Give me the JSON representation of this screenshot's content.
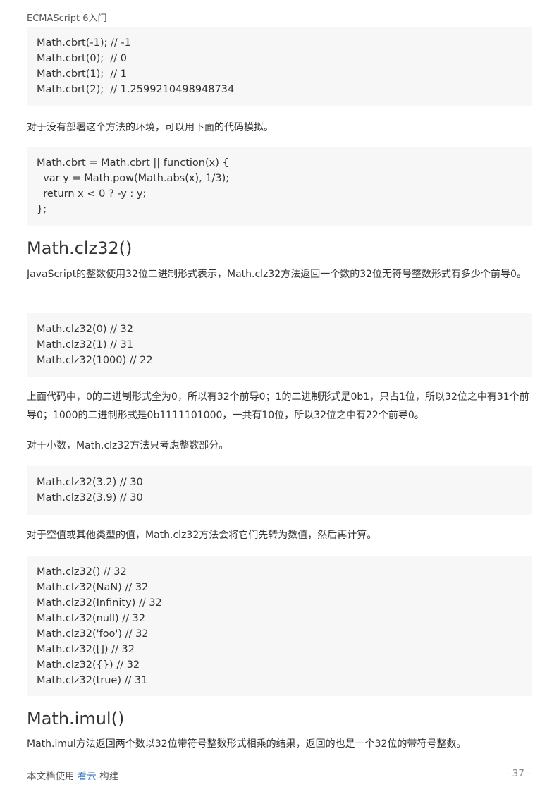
{
  "header": {
    "book_title": "ECMAScript 6入门"
  },
  "blocks": {
    "code1": [
      "Math.cbrt(-1); // -1",
      "Math.cbrt(0);  // 0",
      "Math.cbrt(1);  // 1",
      "Math.cbrt(2);  // 1.2599210498948734"
    ],
    "para1": "对于没有部署这个方法的环境，可以用下面的代码模拟。",
    "code2": [
      "Math.cbrt = Math.cbrt || function(x) {",
      "  var y = Math.pow(Math.abs(x), 1/3);",
      "  return x < 0 ? -y : y;",
      "};"
    ],
    "heading1": "Math.clz32()",
    "para2": "JavaScript的整数使用32位二进制形式表示，Math.clz32方法返回一个数的32位无符号整数形式有多少个前导0。",
    "code3": [
      "Math.clz32(0) // 32",
      "Math.clz32(1) // 31",
      "Math.clz32(1000) // 22"
    ],
    "para3": "上面代码中，0的二进制形式全为0，所以有32个前导0；1的二进制形式是0b1，只占1位，所以32位之中有31个前导0；1000的二进制形式是0b1111101000，一共有10位，所以32位之中有22个前导0。",
    "para4": "对于小数，Math.clz32方法只考虑整数部分。",
    "code4": [
      "Math.clz32(3.2) // 30",
      "Math.clz32(3.9) // 30"
    ],
    "para5": "对于空值或其他类型的值，Math.clz32方法会将它们先转为数值，然后再计算。",
    "code5": [
      "Math.clz32() // 32",
      "Math.clz32(NaN) // 32",
      "Math.clz32(Infinity) // 32",
      "Math.clz32(null) // 32",
      "Math.clz32('foo') // 32",
      "Math.clz32([]) // 32",
      "Math.clz32({}) // 32",
      "Math.clz32(true) // 31"
    ],
    "heading2": "Math.imul()",
    "para6": "Math.imul方法返回两个数以32位带符号整数形式相乘的结果，返回的也是一个32位的带符号整数。"
  },
  "footer": {
    "prefix": "本文档使用",
    "link_text": "看云",
    "suffix": "构建",
    "page_number": "- 37 -"
  }
}
